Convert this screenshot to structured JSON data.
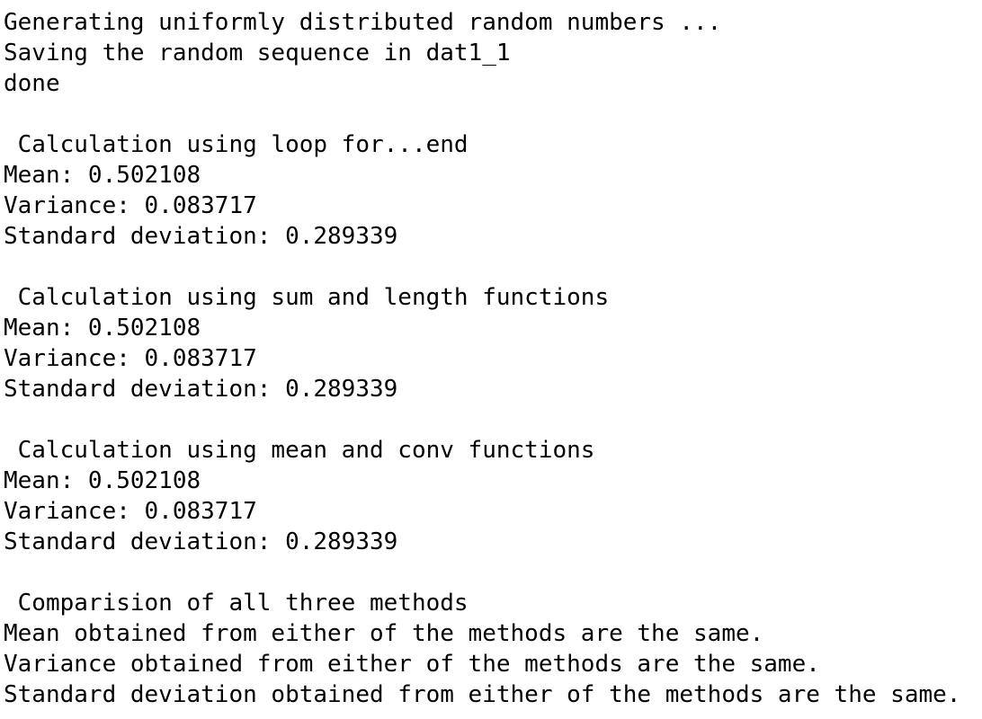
{
  "console": {
    "lines": [
      "Generating uniformly distributed random numbers ...",
      "Saving the random sequence in dat1_1",
      "done",
      "",
      " Calculation using loop for...end",
      "Mean: 0.502108",
      "Variance: 0.083717",
      "Standard deviation: 0.289339",
      "",
      " Calculation using sum and length functions",
      "Mean: 0.502108",
      "Variance: 0.083717",
      "Standard deviation: 0.289339",
      "",
      " Calculation using mean and conv functions",
      "Mean: 0.502108",
      "Variance: 0.083717",
      "Standard deviation: 0.289339",
      "",
      " Comparision of all three methods",
      "Mean obtained from either of the methods are the same.",
      "Variance obtained from either of the methods are the same.",
      "Standard deviation obtained from either of the methods are the same."
    ]
  }
}
